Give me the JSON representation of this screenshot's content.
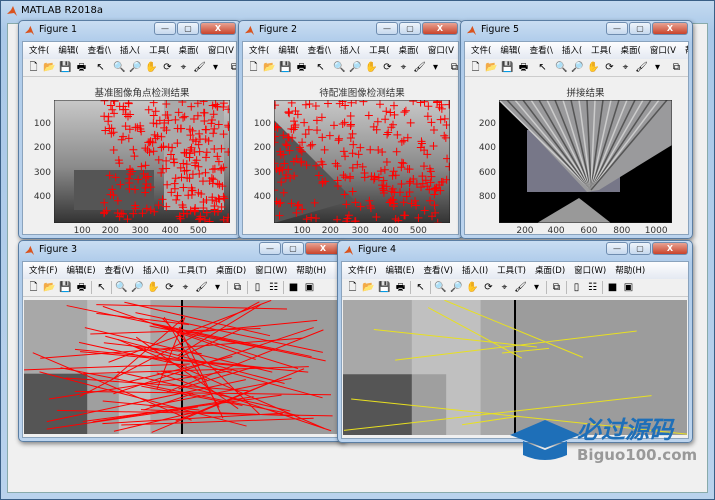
{
  "app": {
    "title": "MATLAB R2018a"
  },
  "menu_short": [
    "文件(",
    "编辑(",
    "查看(\\",
    "插入(",
    "工具(",
    "桌面(",
    "窗口(V",
    "帮助("
  ],
  "menu_full": [
    "文件(F)",
    "编辑(E)",
    "查看(V)",
    "插入(I)",
    "工具(T)",
    "桌面(D)",
    "窗口(W)",
    "帮助(H)"
  ],
  "window_controls": {
    "minimize": "—",
    "maximize": "▢",
    "close": "X"
  },
  "toolbar_icons": [
    "new-file-icon",
    "open-folder-icon",
    "save-icon",
    "print-icon",
    "sep",
    "pointer-icon",
    "sep",
    "zoom-in-icon",
    "zoom-out-icon",
    "pan-hand-icon",
    "rotate-3d-icon",
    "data-cursor-icon",
    "brush-icon",
    "dropdown-icon",
    "sep",
    "link-plot-icon",
    "sep",
    "colorbar-icon",
    "legend-icon",
    "sep",
    "hide-plot-tools-icon",
    "show-plot-tools-icon"
  ],
  "figures": [
    {
      "id": "fig1",
      "title": "Figure 1",
      "plot_title": "基准图像角点检测结果",
      "xticks": [
        "100",
        "200",
        "300",
        "400",
        "500"
      ],
      "yticks": [
        "100",
        "200",
        "300",
        "400"
      ],
      "marker_color": "#ff0000"
    },
    {
      "id": "fig2",
      "title": "Figure 2",
      "plot_title": "待配准图像检测结果",
      "xticks": [
        "100",
        "200",
        "300",
        "400",
        "500"
      ],
      "yticks": [
        "100",
        "200",
        "300",
        "400"
      ],
      "marker_color": "#ff0000"
    },
    {
      "id": "fig5",
      "title": "Figure 5",
      "plot_title": "拼接结果",
      "xticks": [
        "200",
        "400",
        "600",
        "800",
        "1000"
      ],
      "yticks": [
        "200",
        "400",
        "600",
        "800"
      ]
    },
    {
      "id": "fig3",
      "title": "Figure 3",
      "line_color": "#ff0000"
    },
    {
      "id": "fig4",
      "title": "Figure 4",
      "line_color": "#e8e020"
    }
  ],
  "watermark": {
    "cn": "必过源码",
    "en": "Biguo100.com",
    "color": "#1e6fb8"
  }
}
